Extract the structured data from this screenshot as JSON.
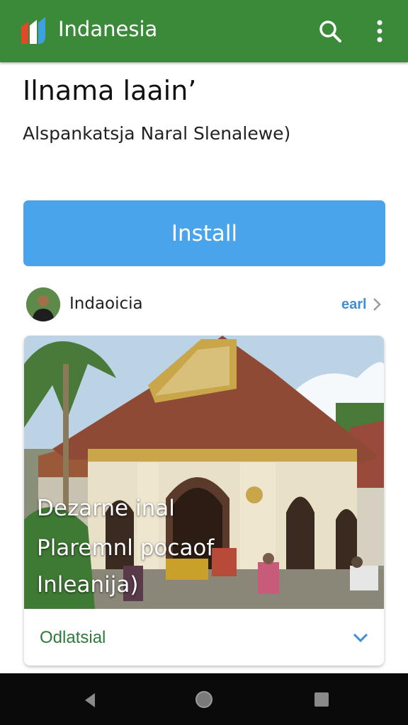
{
  "app_bar": {
    "title": "Indanesia",
    "background": "#3a8a3a",
    "icons": [
      "app-logo-icon",
      "search-icon",
      "more-vert-icon"
    ]
  },
  "listing": {
    "heading": "Ilnama laain’",
    "subheading": "Alspankatsja Naral Slenalewe)"
  },
  "install_button": {
    "label": "Install",
    "color": "#4aa4ec"
  },
  "developer": {
    "name": "Indaoicia",
    "link_label": "earl"
  },
  "featured_card": {
    "overlay_lines": [
      "Dezarne inal",
      "Plaremnl pocaof",
      "Inleanija)"
    ],
    "footer_label": "Odlatsial"
  },
  "system_nav": {
    "icons": [
      "back-icon",
      "home-icon",
      "recents-icon"
    ]
  }
}
